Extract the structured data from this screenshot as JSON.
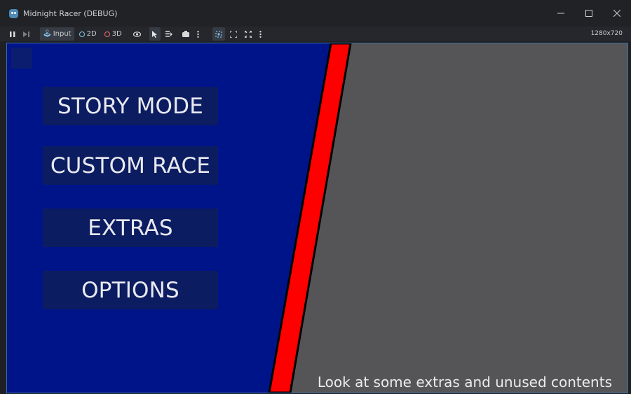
{
  "window": {
    "title": "Midnight Racer (DEBUG)",
    "icon": "godot-icon",
    "controls": [
      "minimize-icon",
      "maximize-icon",
      "close-icon"
    ]
  },
  "toolbar": {
    "pause": "pause-icon",
    "step": "step-frame-icon",
    "input_label": "Input",
    "label_2d": "2D",
    "label_3d": "3D",
    "resolution": "1280x720"
  },
  "game": {
    "colors": {
      "left_panel": "#001489",
      "stripe": "#ff0000",
      "right_panel": "#555456",
      "button_bg": "#0c1c60"
    },
    "menu": {
      "story_mode": "STORY MODE",
      "custom_race": "CUSTOM RACE",
      "extras": "EXTRAS",
      "options": "OPTIONS"
    },
    "description": "Look at some extras and unused contents"
  }
}
